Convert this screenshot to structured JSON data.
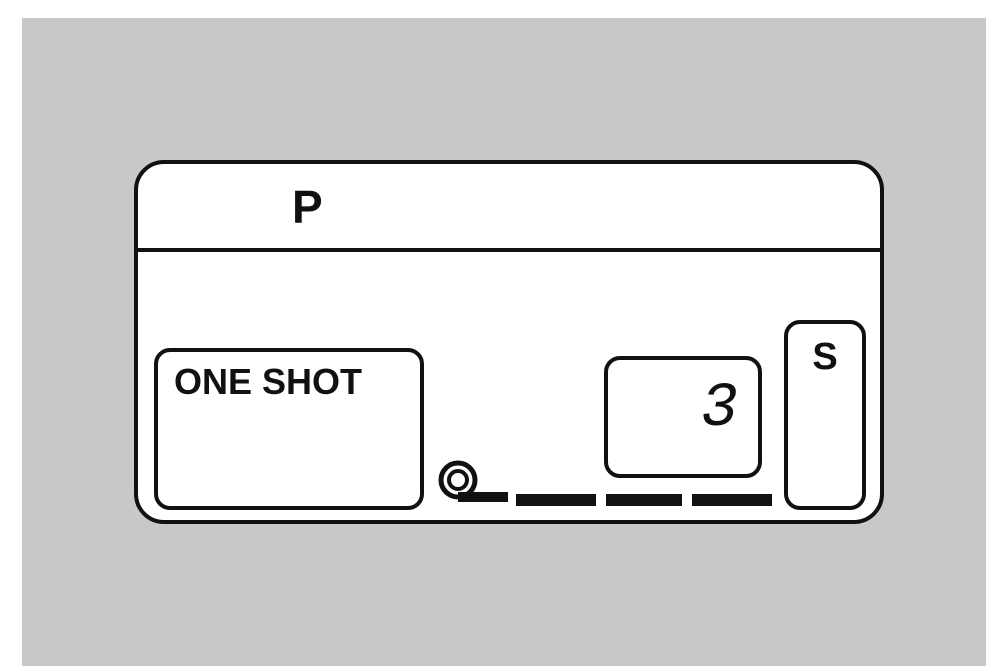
{
  "lcd": {
    "mode": "P",
    "drive_mode": "ONE SHOT",
    "frame_counter": "3",
    "side_indicator": "S",
    "film_icon": "film-cartridge-icon",
    "progress_segments": 3
  }
}
